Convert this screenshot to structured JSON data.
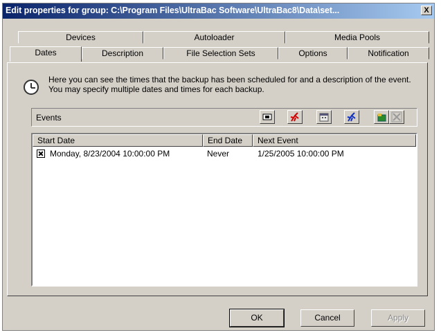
{
  "window": {
    "title": "Edit properties for group: C:\\Program Files\\UltraBac Software\\UltraBac8\\Data\\set...",
    "close_label": "X"
  },
  "tabs_back": [
    "Devices",
    "Autoloader",
    "Media Pools"
  ],
  "tabs_front": [
    "Dates",
    "Description",
    "File Selection Sets",
    "Options",
    "Notification"
  ],
  "active_tab": "Dates",
  "description": "Here you can see the times that the backup has been scheduled for and a description of the event. You may specify multiple dates and times for each backup.",
  "events": {
    "label": "Events",
    "toolbar_icons": [
      "properties-icon",
      "delete-red-runner-icon",
      "calendar-icon",
      "run-blue-runner-icon",
      "add-schedule-icon",
      "disabled-x-icon"
    ]
  },
  "list": {
    "columns": [
      "Start Date",
      "End Date",
      "Next Event"
    ],
    "rows": [
      {
        "checked": true,
        "start": "Monday, 8/23/2004 10:00:00 PM",
        "end": "Never",
        "next": "1/25/2005 10:00:00 PM"
      }
    ]
  },
  "buttons": {
    "ok": "OK",
    "cancel": "Cancel",
    "apply": "Apply"
  }
}
